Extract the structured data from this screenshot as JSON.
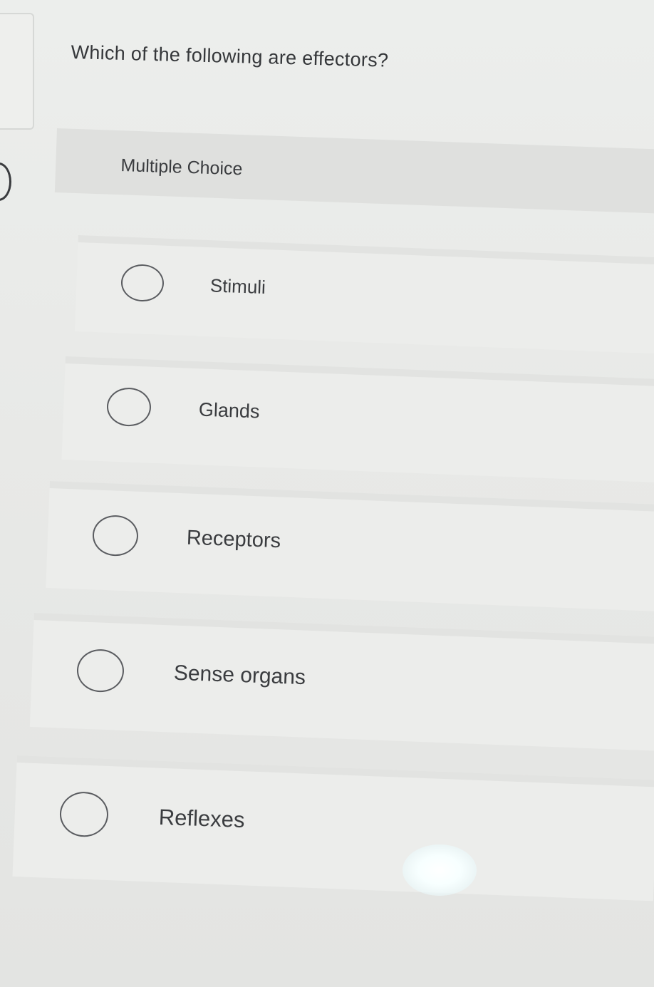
{
  "question": {
    "text": "Which of the following are effectors?"
  },
  "question_type": {
    "label": "Multiple Choice"
  },
  "options": [
    {
      "label": "Stimuli",
      "selected": false
    },
    {
      "label": "Glands",
      "selected": false
    },
    {
      "label": "Receptors",
      "selected": false
    },
    {
      "label": "Sense organs",
      "selected": false
    },
    {
      "label": "Reflexes",
      "selected": false
    }
  ],
  "icons": {
    "radio": "radio-unselected-icon",
    "nav": "chevron-right-icon"
  },
  "colors": {
    "background": "#e6e7e5",
    "text": "#3a3c3f",
    "radio_border": "#5a5c60"
  }
}
